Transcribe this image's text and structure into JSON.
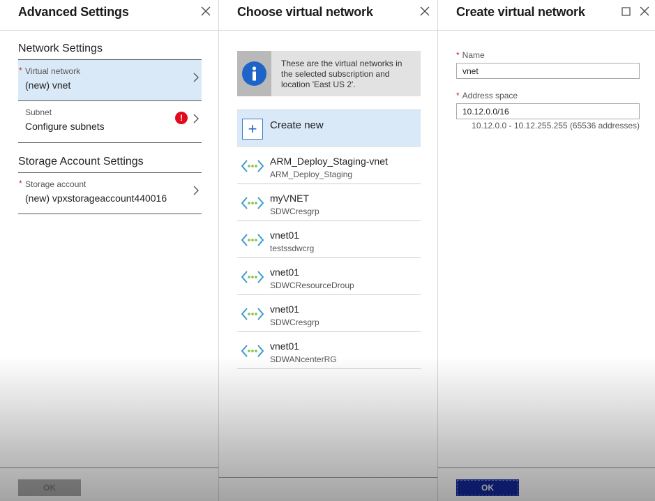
{
  "advanced_settings": {
    "title": "Advanced Settings",
    "close_icon": "close-icon",
    "network_settings_title": "Network Settings",
    "virtual_network": {
      "label": "Virtual network",
      "value": "(new) vnet",
      "required": true,
      "selected": true
    },
    "subnet": {
      "label": "Subnet",
      "value": "Configure subnets",
      "error_icon": "!"
    },
    "storage_settings_title": "Storage Account Settings",
    "storage_account": {
      "label": "Storage account",
      "value": "(new) vpxstorageaccount440016",
      "required": true
    },
    "ok_label": "OK",
    "ok_enabled": false
  },
  "choose_vnet": {
    "title": "Choose virtual network",
    "close_icon": "close-icon",
    "info_text": "These are the virtual networks in the selected subscription and location 'East US 2'.",
    "create_new_label": "Create new",
    "items": [
      {
        "name": "ARM_Deploy_Staging-vnet",
        "resource_group": "ARM_Deploy_Staging"
      },
      {
        "name": "myVNET",
        "resource_group": "SDWCresgrp"
      },
      {
        "name": "vnet01",
        "resource_group": "testssdwcrg"
      },
      {
        "name": "vnet01",
        "resource_group": "SDWCResourceDroup"
      },
      {
        "name": "vnet01",
        "resource_group": "SDWCresgrp"
      },
      {
        "name": "vnet01",
        "resource_group": "SDWANcenterRG"
      }
    ]
  },
  "create_vnet": {
    "title": "Create virtual network",
    "maximize_icon": "maximize-icon",
    "close_icon": "close-icon",
    "name_label": "Name",
    "name_value": "vnet",
    "address_label": "Address space",
    "address_value": "10.12.0.0/16",
    "address_hint": "10.12.0.0 - 10.12.255.255 (65536 addresses)",
    "ok_label": "OK"
  },
  "colors": {
    "selected_row": "#d9e9f8",
    "error": "#e00b1c",
    "info_blue": "#1e64c8",
    "primary_button": "#14289a",
    "required_star": "#c2281f"
  }
}
